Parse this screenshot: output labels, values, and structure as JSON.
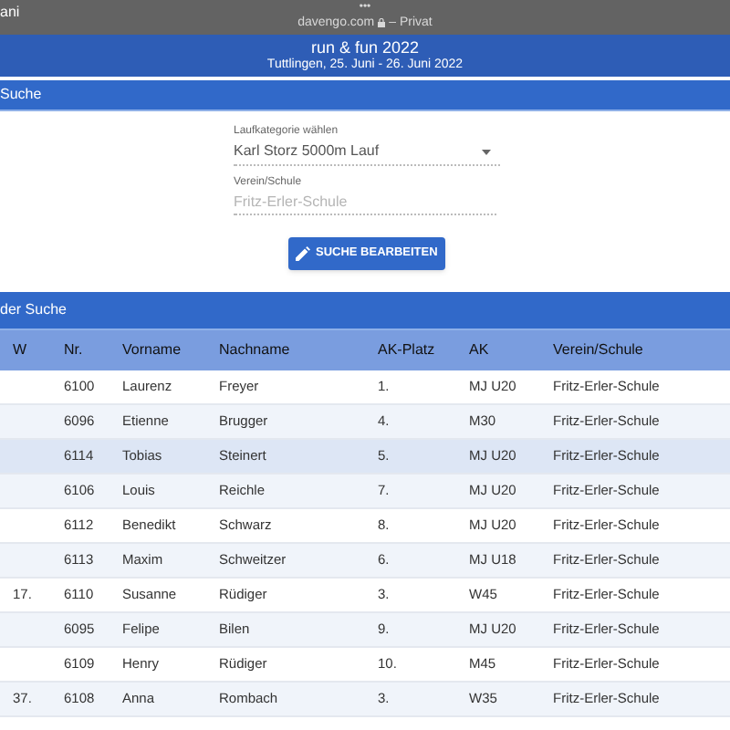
{
  "browser_bar": {
    "left_text": "ani",
    "dots": "•••",
    "url": "davengo.com",
    "privacy": "– Privat"
  },
  "event": {
    "title": "run & fun 2022",
    "subtitle": "Tuttlingen, 25. Juni - 26. Juni 2022"
  },
  "search_section": {
    "title": "Suche"
  },
  "form": {
    "category_label": "Laufkategorie wählen",
    "category_value": "Karl Storz 5000m Lauf",
    "club_label": "Verein/Schule",
    "club_placeholder": "Fritz-Erler-Schule",
    "button": "SUCHE BEARBEITEN"
  },
  "results_section": {
    "title": "der Suche"
  },
  "table": {
    "columns": [
      "W",
      "Nr.",
      "Vorname",
      "Nachname",
      "AK-Platz",
      "AK",
      "Verein/Schule"
    ],
    "rows": [
      {
        "cells": [
          "",
          "6100",
          "Laurenz",
          "Freyer",
          "1.",
          "MJ U20",
          "Fritz-Erler-Schule"
        ],
        "selected": false
      },
      {
        "cells": [
          "",
          "6096",
          "Etienne",
          "Brugger",
          "4.",
          "M30",
          "Fritz-Erler-Schule"
        ],
        "selected": false
      },
      {
        "cells": [
          "",
          "6114",
          "Tobias",
          "Steinert",
          "5.",
          "MJ U20",
          "Fritz-Erler-Schule"
        ],
        "selected": true
      },
      {
        "cells": [
          "",
          "6106",
          "Louis",
          "Reichle",
          "7.",
          "MJ U20",
          "Fritz-Erler-Schule"
        ],
        "selected": false
      },
      {
        "cells": [
          "",
          "6112",
          "Benedikt",
          "Schwarz",
          "8.",
          "MJ U20",
          "Fritz-Erler-Schule"
        ],
        "selected": false
      },
      {
        "cells": [
          "",
          "6113",
          "Maxim",
          "Schweitzer",
          "6.",
          "MJ U18",
          "Fritz-Erler-Schule"
        ],
        "selected": false
      },
      {
        "cells": [
          "17.",
          "6110",
          "Susanne",
          "Rüdiger",
          "3.",
          "W45",
          "Fritz-Erler-Schule"
        ],
        "selected": false
      },
      {
        "cells": [
          "",
          "6095",
          "Felipe",
          "Bilen",
          "9.",
          "MJ U20",
          "Fritz-Erler-Schule"
        ],
        "selected": false
      },
      {
        "cells": [
          "",
          "6109",
          "Henry",
          "Rüdiger",
          "10.",
          "M45",
          "Fritz-Erler-Schule"
        ],
        "selected": false
      },
      {
        "cells": [
          "37.",
          "6108",
          "Anna",
          "Rombach",
          "3.",
          "W35",
          "Fritz-Erler-Schule"
        ],
        "selected": false
      }
    ]
  }
}
